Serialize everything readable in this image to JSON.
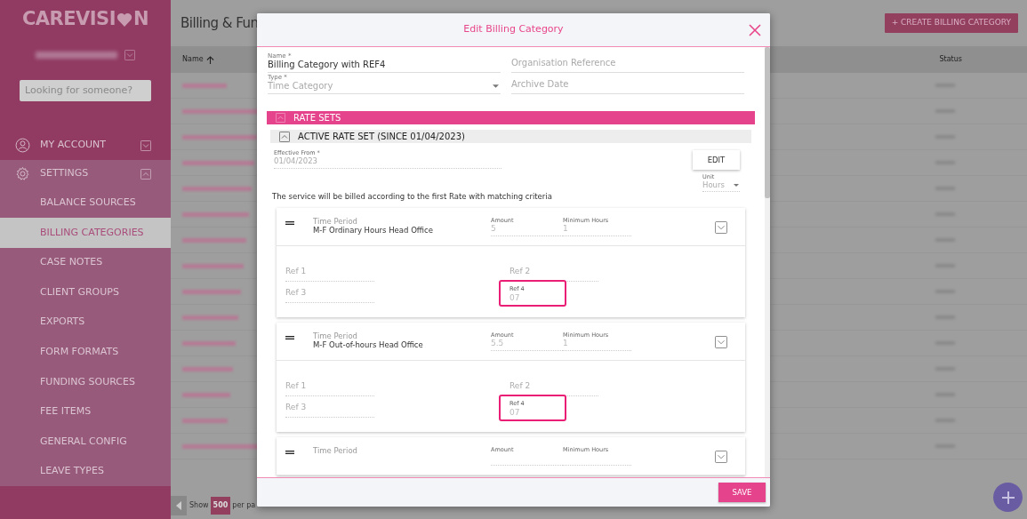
{
  "logo": {
    "text_start": "CAREVISI",
    "text_end": "N"
  },
  "sidebar": {
    "search": {
      "placeholder": "Looking for someone?"
    },
    "items": [
      {
        "label": "MY ACCOUNT",
        "expanded": false
      },
      {
        "label": "SETTINGS",
        "expanded": true,
        "children": [
          {
            "label": "BALANCE SOURCES",
            "selected": false
          },
          {
            "label": "BILLING CATEGORIES",
            "selected": true
          },
          {
            "label": "CASE NOTES",
            "selected": false
          },
          {
            "label": "CLIENT GROUPS",
            "selected": false
          },
          {
            "label": "EXPORTS",
            "selected": false
          },
          {
            "label": "FORM FORMATS",
            "selected": false
          },
          {
            "label": "FUNDING SOURCES",
            "selected": false
          },
          {
            "label": "FEE ITEMS",
            "selected": false
          },
          {
            "label": "GENERAL CONFIG",
            "selected": false
          },
          {
            "label": "LEAVE TYPES",
            "selected": false
          }
        ]
      }
    ]
  },
  "page": {
    "title": "Billing & Fun",
    "create_button": "+ CREATE BILLING CATEGORY",
    "columns": [
      "Name",
      "Status"
    ],
    "pagination": {
      "show": "Show",
      "page_size": "500",
      "per_page": "per pa"
    }
  },
  "modal": {
    "title": "Edit Billing Category",
    "fields": [
      {
        "label": "Name *",
        "value": "Billing Category with REF4"
      },
      {
        "label": "Organisation Reference"
      },
      {
        "label": "Type *",
        "value": "Time Category",
        "kind": "select"
      },
      {
        "label": "Archive Date"
      }
    ],
    "rate_sets_header": "RATE SETS",
    "active_rate_set": {
      "title": "ACTIVE RATE SET (SINCE 01/04/2023)",
      "effective_label": "Effective From *",
      "effective_value": "01/04/2023",
      "edit_button": "EDIT",
      "unit_label": "Unit",
      "unit_value": "Hours"
    },
    "note": "The service will be billed according to the first Rate with matching criteria",
    "rates": [
      {
        "period_label": "Time Period",
        "period": "M-F Ordinary Hours Head Office",
        "amount_label": "Amount",
        "amount": "5",
        "min_label": "Minimum Hours",
        "min": "1",
        "refs": [
          {
            "label": "Ref 1"
          },
          {
            "label": "Ref 3"
          },
          {
            "label": "Ref 2"
          },
          {
            "label": "Ref 4",
            "value": "07",
            "highlighted": true
          }
        ]
      },
      {
        "period_label": "Time Period",
        "period": "M-F Out-of-hours Head Office",
        "amount_label": "Amount",
        "amount": "5.5",
        "min_label": "Minimum Hours",
        "min": "1",
        "refs": [
          {
            "label": "Ref 1"
          },
          {
            "label": "Ref 3"
          },
          {
            "label": "Ref 2"
          },
          {
            "label": "Ref 4",
            "value": "07",
            "highlighted": true
          }
        ]
      },
      {
        "period_label": "Time Period",
        "amount_label": "Amount",
        "min_label": "Minimum Hours"
      }
    ],
    "save_button": "SAVE"
  }
}
